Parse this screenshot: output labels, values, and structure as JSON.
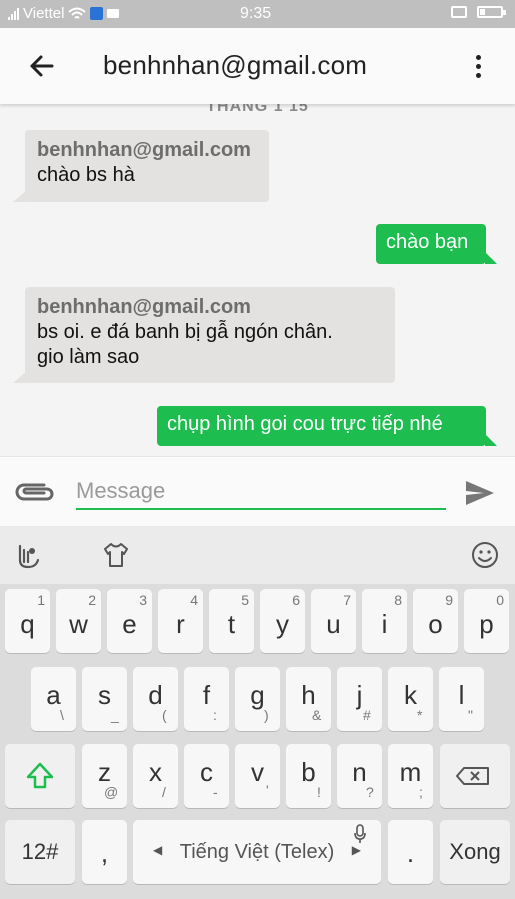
{
  "status_bar": {
    "carrier": "Viettel",
    "time": "9:35"
  },
  "app_bar": {
    "title": "benhnhan@gmail.com",
    "back_icon": "arrow-left-icon",
    "menu_icon": "more-vert-icon"
  },
  "chat": {
    "date_label": "THÁNG 1 15",
    "messages": [
      {
        "direction": "incoming",
        "sender": "benhnhan@gmail.com",
        "lines": [
          "chào bs hà"
        ]
      },
      {
        "direction": "outgoing",
        "lines": [
          "chào bạn"
        ]
      },
      {
        "direction": "incoming",
        "sender": "benhnhan@gmail.com",
        "lines": [
          "bs oi. e đá banh bị gẫ ngón chân.",
          "gio làm sao"
        ]
      },
      {
        "direction": "outgoing",
        "lines": [
          "chụp hình goi cou trực tiếp nhé"
        ]
      }
    ]
  },
  "compose": {
    "placeholder": "Message",
    "attach_icon": "paperclip-icon",
    "send_icon": "send-icon"
  },
  "keyboard": {
    "toolbar_icons": [
      "gesture-icon",
      "shirt-theme-icon",
      "emoji-icon"
    ],
    "row1": [
      {
        "main": "q",
        "sub": "1"
      },
      {
        "main": "w",
        "sub": "2"
      },
      {
        "main": "e",
        "sub": "3"
      },
      {
        "main": "r",
        "sub": "4"
      },
      {
        "main": "t",
        "sub": "5"
      },
      {
        "main": "y",
        "sub": "6"
      },
      {
        "main": "u",
        "sub": "7"
      },
      {
        "main": "i",
        "sub": "8"
      },
      {
        "main": "o",
        "sub": "9"
      },
      {
        "main": "p",
        "sub": "0"
      }
    ],
    "row2": [
      {
        "main": "a",
        "sub": "\\"
      },
      {
        "main": "s",
        "sub": "_"
      },
      {
        "main": "d",
        "sub": "("
      },
      {
        "main": "f",
        "sub": ":"
      },
      {
        "main": "g",
        "sub": ")"
      },
      {
        "main": "h",
        "sub": "&"
      },
      {
        "main": "j",
        "sub": "#"
      },
      {
        "main": "k",
        "sub": "*"
      },
      {
        "main": "l",
        "sub": "\""
      }
    ],
    "row3": [
      {
        "main": "z",
        "sub": "@"
      },
      {
        "main": "x",
        "sub": "/"
      },
      {
        "main": "c",
        "sub": "-"
      },
      {
        "main": "v",
        "sub": "'"
      },
      {
        "main": "b",
        "sub": "!"
      },
      {
        "main": "n",
        "sub": "?"
      },
      {
        "main": "m",
        "sub": ";"
      }
    ],
    "shift_icon": "shift-arrow-icon",
    "backspace_icon": "backspace-icon",
    "numbers_key": "12#",
    "comma_key": ",",
    "space_label": "Tiếng Việt (Telex)",
    "mic_icon": "microphone-icon",
    "period_key": ".",
    "done_key": "Xong"
  },
  "colors": {
    "accent_green": "#1ebd4f",
    "incoming_bubble": "#e3e2e0",
    "status_bar": "#bfbfbf"
  }
}
